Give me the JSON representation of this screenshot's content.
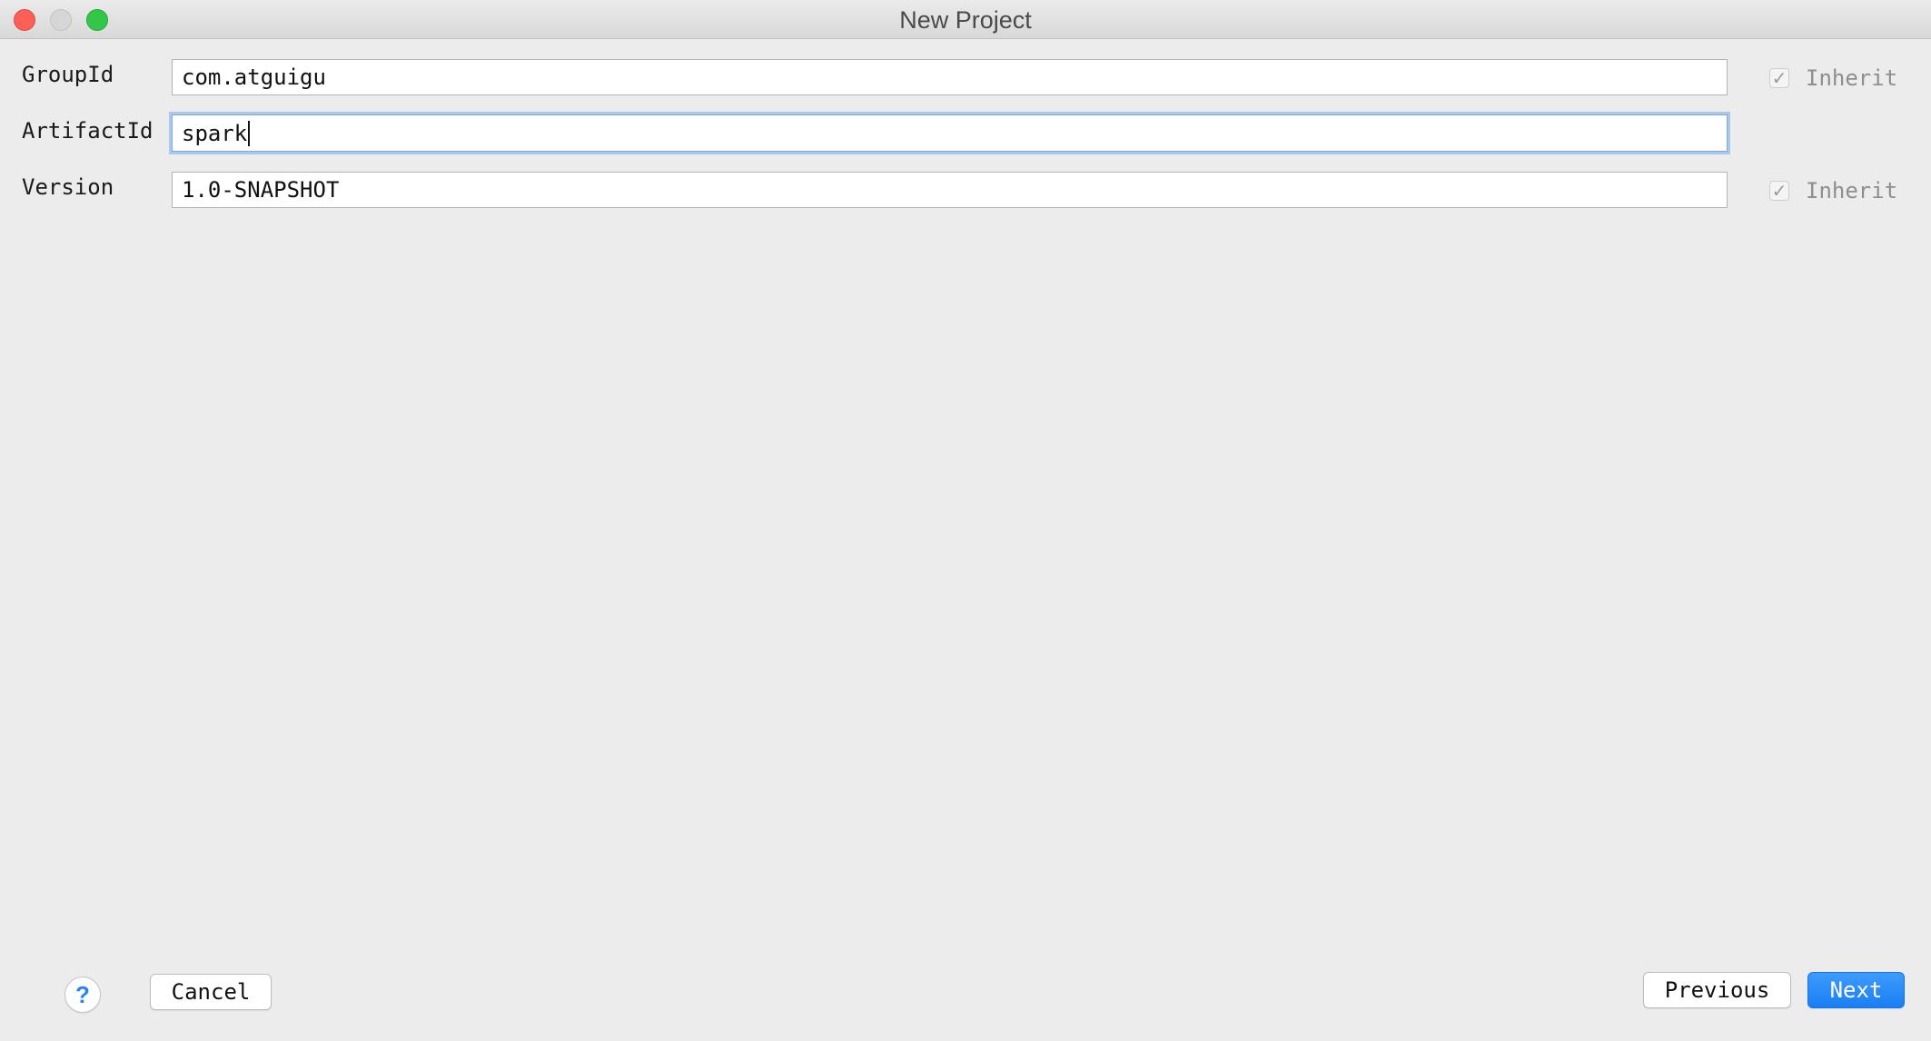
{
  "window": {
    "title": "New Project"
  },
  "form": {
    "group_id": {
      "label": "GroupId",
      "value": "com.atguigu",
      "inherit_label": "Inherit",
      "inherit_checked": true
    },
    "artifact_id": {
      "label": "ArtifactId",
      "value": "spark"
    },
    "version": {
      "label": "Version",
      "value": "1.0-SNAPSHOT",
      "inherit_label": "Inherit",
      "inherit_checked": true
    }
  },
  "footer": {
    "help_label": "?",
    "cancel_label": "Cancel",
    "previous_label": "Previous",
    "next_label": "Next"
  },
  "icons": {
    "check": "✓"
  },
  "colors": {
    "accent": "#1a7ff5",
    "focus_ring": "#a9c8ec",
    "close": "#fc5f57",
    "maximize": "#33c748"
  }
}
